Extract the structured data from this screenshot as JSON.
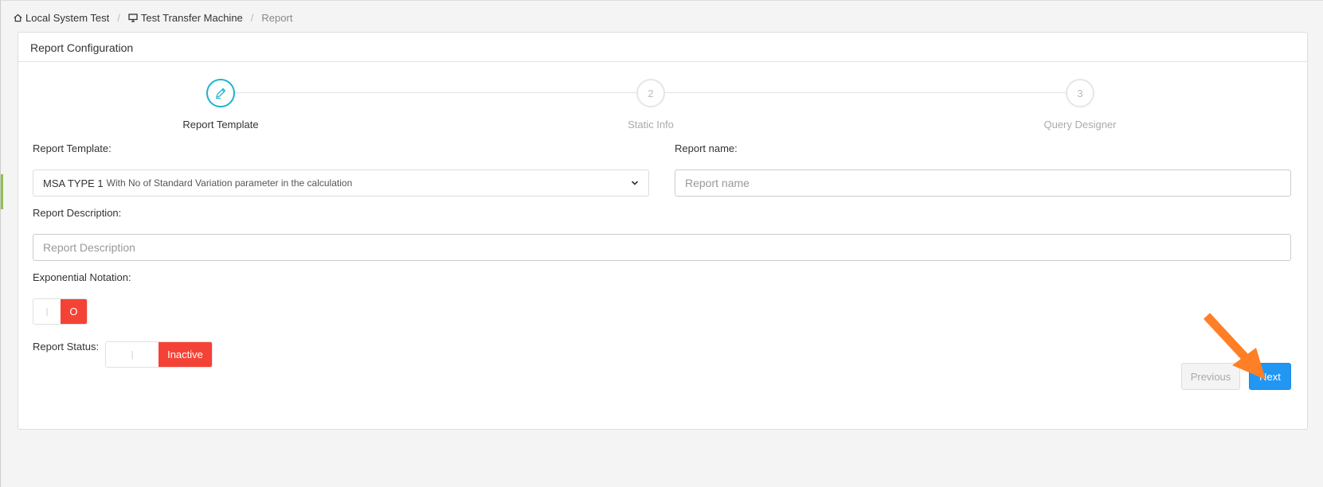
{
  "breadcrumb": {
    "items": [
      {
        "label": "Local System Test",
        "icon": "home-icon"
      },
      {
        "label": "Test Transfer Machine",
        "icon": "monitor-icon"
      },
      {
        "label": "Report",
        "icon": ""
      }
    ]
  },
  "card": {
    "title": "Report Configuration"
  },
  "stepper": {
    "steps": [
      {
        "number": "",
        "label": "Report Template",
        "active": true,
        "icon": "pencil-icon"
      },
      {
        "number": "2",
        "label": "Static Info",
        "active": false
      },
      {
        "number": "3",
        "label": "Query Designer",
        "active": false
      }
    ]
  },
  "form": {
    "template_label": "Report Template:",
    "template_value_main": "MSA TYPE 1",
    "template_value_sub": "With No of Standard Variation parameter in the calculation",
    "name_label": "Report name:",
    "name_placeholder": "Report name",
    "name_value": "",
    "description_label": "Report Description:",
    "description_placeholder": "Report Description",
    "description_value": "",
    "exponential_label": "Exponential Notation:",
    "exponential_off_text": "|",
    "exponential_on_text": "O",
    "status_label": "Report Status:",
    "status_off_text": "|",
    "status_on_text": "Inactive"
  },
  "buttons": {
    "previous": "Previous",
    "next": "Next"
  },
  "colors": {
    "accent": "#1fb3d1",
    "primary": "#2196f3",
    "danger": "#f44336",
    "annotation_arrow": "#ff7f27"
  }
}
